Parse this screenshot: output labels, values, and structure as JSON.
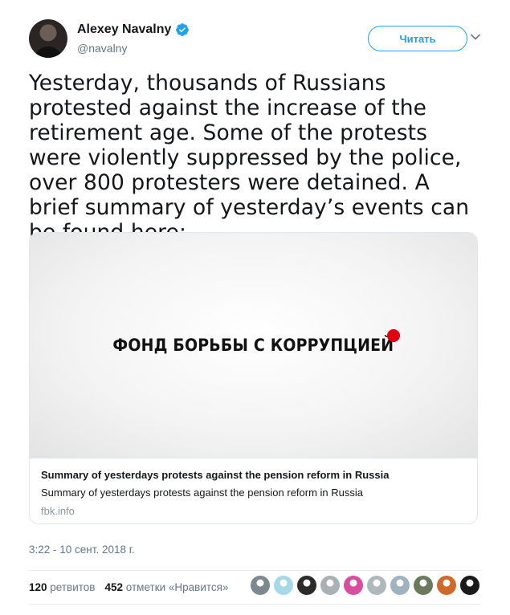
{
  "tweet": {
    "author_name": "Alexey Navalny",
    "author_handle": "@navalny",
    "follow_label": "Читать",
    "text": "Yesterday, thousands of Russians protested against the increase of the retirement age. Some of the protests were violently suppressed by the police, over 800 protesters were detained. A brief summary of yesterday’s events can be found here:",
    "timestamp": "3:22 - 10 сент. 2018 г."
  },
  "card": {
    "image_text": "ФОНД БОРЬБЫ С КОРРУПЦИЕЙ",
    "title": "Summary of yesterdays protests against the pension reform in Russia",
    "description": "Summary of yesterdays protests against the pension reform in Russia",
    "domain": "fbk.info",
    "brand_dot_color": "#e1000f"
  },
  "stats": {
    "retweets_count": "120",
    "retweets_label": "ретвитов",
    "likes_count": "452",
    "likes_label": "отметки «Нравится»"
  },
  "likers": [
    {
      "color": "#7c8a8f",
      "icon": "avatar-icon"
    },
    {
      "color": "#a6d8e8",
      "icon": "avatar-icon"
    },
    {
      "color": "#2d2a2a",
      "icon": "avatar-icon"
    },
    {
      "color": "#aab1b5",
      "icon": "avatar-icon"
    },
    {
      "color": "#d94fa0",
      "icon": "avatar-icon"
    },
    {
      "color": "#b0b8bc",
      "icon": "avatar-icon"
    },
    {
      "color": "#9fb2bd",
      "icon": "avatar-icon"
    },
    {
      "color": "#6b7a5c",
      "icon": "avatar-icon"
    },
    {
      "color": "#d06a2a",
      "icon": "avatar-icon"
    },
    {
      "color": "#1a1a1a",
      "icon": "avatar-icon"
    }
  ],
  "accent_color": "#1da1f2"
}
